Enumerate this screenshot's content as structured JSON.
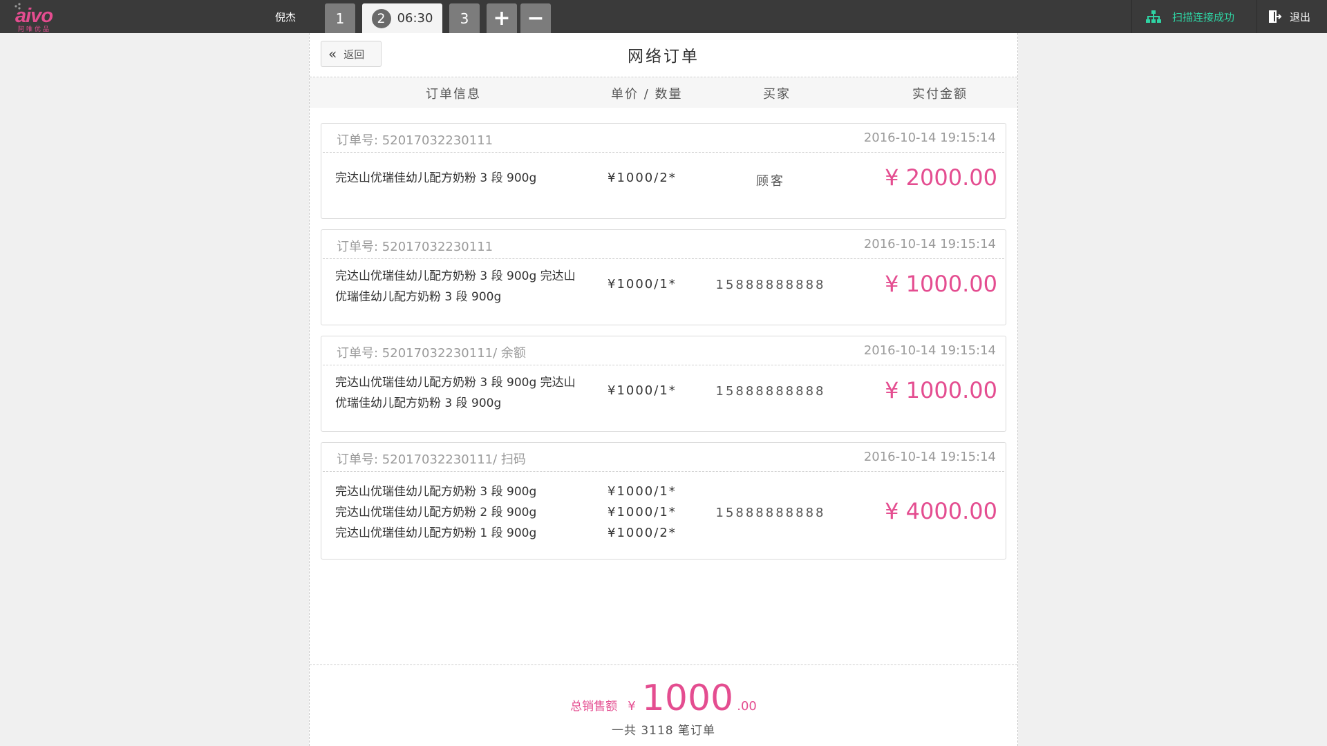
{
  "app": {
    "logo_text": "aivo",
    "logo_sub": "阿唯优品",
    "username": "倪杰"
  },
  "tabs": {
    "tab1": "1",
    "tab2_num": "2",
    "tab2_time": "06:30",
    "tab3": "3",
    "add": "+",
    "remove": "−"
  },
  "status": {
    "connection": "扫描连接成功",
    "logout": "退出",
    "connection_color": "#2fd3a3"
  },
  "page": {
    "back_label": "返回",
    "title": "网络订单"
  },
  "columns": {
    "info": "订单信息",
    "price_qty": "单价 / 数量",
    "buyer": "买家",
    "paid": "实付金额"
  },
  "orders": [
    {
      "order_no": "订单号:  52017032230111",
      "time": "2016-10-14  19:15:14",
      "items": [
        "完达山优瑞佳幼儿配方奶粉 3 段 900g"
      ],
      "prices": [
        "¥1000/2*"
      ],
      "buyer": "顾客",
      "amount": "¥  2000.00"
    },
    {
      "order_no": "订单号:  52017032230111",
      "time": "2016-10-14  19:15:14",
      "items": [
        "完达山优瑞佳幼儿配方奶粉 3 段 900g 完达山优瑞佳幼儿配方奶粉 3 段 900g"
      ],
      "prices": [
        "¥1000/1*"
      ],
      "buyer": "15888888888",
      "amount": "¥  1000.00"
    },
    {
      "order_no": "订单号:  52017032230111/ 余额",
      "time": "2016-10-14  19:15:14",
      "items": [
        "完达山优瑞佳幼儿配方奶粉 3 段 900g 完达山优瑞佳幼儿配方奶粉 3 段 900g"
      ],
      "prices": [
        "¥1000/1*"
      ],
      "buyer": "15888888888",
      "amount": "¥  1000.00"
    },
    {
      "order_no": "订单号:  52017032230111/ 扫码",
      "time": "2016-10-14  19:15:14",
      "items": [
        "完达山优瑞佳幼儿配方奶粉 3 段 900g",
        "完达山优瑞佳幼儿配方奶粉 2 段 900g",
        "完达山优瑞佳幼儿配方奶粉 1 段 900g"
      ],
      "prices": [
        "¥1000/1*",
        "¥1000/1*",
        "¥1000/2*"
      ],
      "buyer": "15888888888",
      "amount": "¥  4000.00"
    }
  ],
  "summary": {
    "total_label": "总销售额",
    "currency": "¥",
    "total_int": "1000",
    "total_dec": ".00",
    "count_text": "一共 3118 笔订单"
  },
  "colors": {
    "accent": "#e44d90",
    "topbar": "#3a3a3a"
  }
}
